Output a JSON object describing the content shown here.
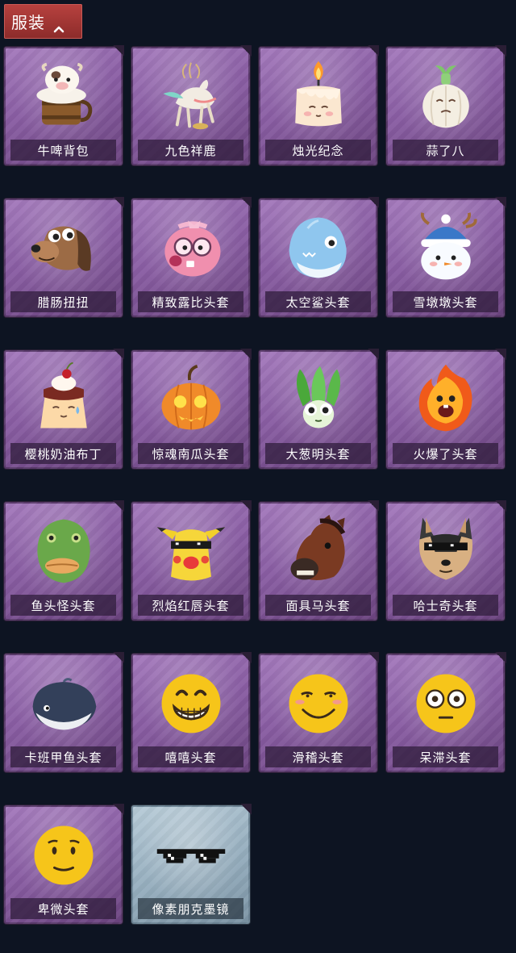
{
  "header": {
    "tab_label": "服装",
    "icon": "chevron-up-icon"
  },
  "items": [
    {
      "label": "牛啤背包",
      "icon": "cow-beer-mug-icon",
      "rarity": "purple"
    },
    {
      "label": "九色祥鹿",
      "icon": "deer-icon",
      "rarity": "purple"
    },
    {
      "label": "烛光纪念",
      "icon": "candle-icon",
      "rarity": "purple"
    },
    {
      "label": "蒜了八",
      "icon": "garlic-icon",
      "rarity": "purple"
    },
    {
      "label": "腊肠扭扭",
      "icon": "sausage-dog-icon",
      "rarity": "purple"
    },
    {
      "label": "精致露比头套",
      "icon": "pink-beaver-icon",
      "rarity": "purple"
    },
    {
      "label": "太空鲨头套",
      "icon": "shark-icon",
      "rarity": "purple"
    },
    {
      "label": "雪墩墩头套",
      "icon": "snowman-icon",
      "rarity": "purple"
    },
    {
      "label": "樱桃奶油布丁",
      "icon": "pudding-icon",
      "rarity": "purple"
    },
    {
      "label": "惊魂南瓜头套",
      "icon": "pumpkin-icon",
      "rarity": "purple"
    },
    {
      "label": "大葱明头套",
      "icon": "scallion-icon",
      "rarity": "purple"
    },
    {
      "label": "火爆了头套",
      "icon": "fireball-icon",
      "rarity": "purple"
    },
    {
      "label": "鱼头怪头套",
      "icon": "fish-head-icon",
      "rarity": "purple"
    },
    {
      "label": "烈焰红唇头套",
      "icon": "pikachu-lips-icon",
      "rarity": "purple"
    },
    {
      "label": "面具马头套",
      "icon": "horse-mask-icon",
      "rarity": "purple"
    },
    {
      "label": "哈士奇头套",
      "icon": "husky-icon",
      "rarity": "purple"
    },
    {
      "label": "卡班甲鱼头套",
      "icon": "turtle-icon",
      "rarity": "purple"
    },
    {
      "label": "嘻嘻头套",
      "icon": "grin-emoji-icon",
      "rarity": "purple"
    },
    {
      "label": "滑稽头套",
      "icon": "smirk-emoji-icon",
      "rarity": "purple"
    },
    {
      "label": "呆滞头套",
      "icon": "dazed-emoji-icon",
      "rarity": "purple"
    },
    {
      "label": "卑微头套",
      "icon": "humble-emoji-icon",
      "rarity": "purple"
    },
    {
      "label": "像素朋克墨镜",
      "icon": "pixel-sunglasses-icon",
      "rarity": "blue"
    }
  ],
  "colors": {
    "background": "#0d1422",
    "header_tab": "#a8383a",
    "purple_card": "#8a5ea4",
    "blue_card": "#98b0c0"
  }
}
